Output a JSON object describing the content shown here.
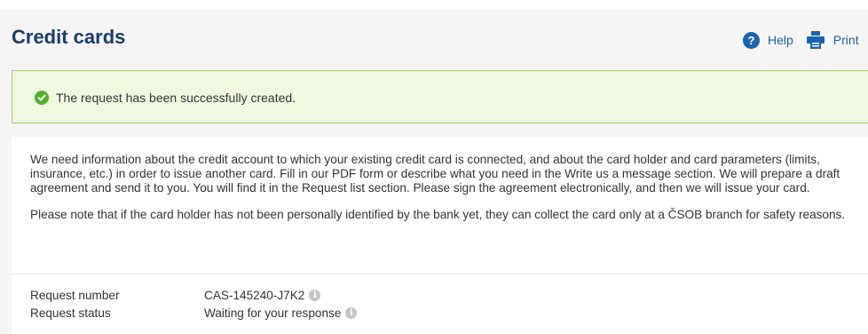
{
  "header": {
    "title": "Credit cards",
    "help_label": "Help",
    "print_label": "Print",
    "help_icon_glyph": "?"
  },
  "alert": {
    "message": "The request has been successfully created.",
    "type": "success"
  },
  "content": {
    "paragraph_1": "We need information about the credit account to which your existing credit card is connected, and about the card holder and card parameters (limits, insurance, etc.) in order to issue another card. Fill in our PDF form or describe what you need in the Write us a message section. We will prepare a draft agreement and send it to you. You will find it in the Request list section. Please sign the agreement electronically, and then we will issue your card.",
    "paragraph_2": "Please note that if the card holder has not been personally identified by the bank yet, they can collect the card only at a ČSOB branch for safety reasons."
  },
  "details": [
    {
      "label": "Request number",
      "value": "CAS-145240-J7K2"
    },
    {
      "label": "Request status",
      "value": "Waiting for your response"
    }
  ],
  "info_icon_glyph": "i",
  "colors": {
    "title": "#1a3d6b",
    "link": "#1b63ad",
    "success_bg": "#eef9e0",
    "success_border": "#9ed06b",
    "success_icon": "#57ad2e",
    "page_bg": "#f5f5f5"
  }
}
